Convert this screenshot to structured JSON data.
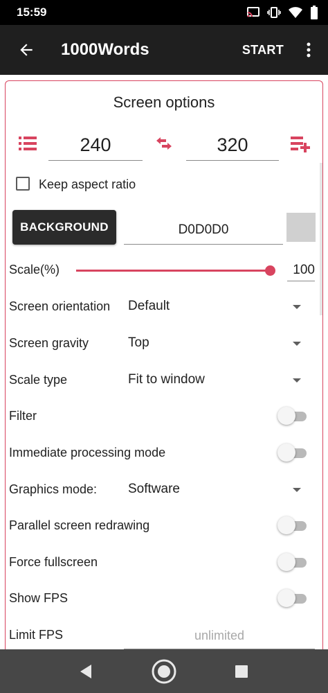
{
  "status_bar": {
    "time": "15:59",
    "icons": [
      "cast-icon",
      "vibrate-icon",
      "wifi-icon",
      "battery-icon"
    ]
  },
  "app_bar": {
    "back_icon": "arrow-left-icon",
    "title": "1000Words",
    "start_label": "START",
    "overflow_icon": "more-vert-icon"
  },
  "screen_options": {
    "title": "Screen options",
    "width_value": "240",
    "height_value": "320",
    "keep_aspect_label": "Keep aspect ratio",
    "keep_aspect_checked": false,
    "background_button": "BACKGROUND",
    "background_color_value": "D0D0D0",
    "background_swatch_color": "#d0d0d0",
    "scale_label": "Scale(%)",
    "scale_value": "100",
    "scale_slider_level": 1.0,
    "accent_color": "#d8445f"
  },
  "dropdowns": [
    {
      "label": "Screen orientation",
      "value": "Default"
    },
    {
      "label": "Screen gravity",
      "value": "Top"
    },
    {
      "label": "Scale type",
      "value": "Fit to window"
    },
    {
      "label": "Graphics mode:",
      "value": "Software"
    }
  ],
  "toggles": [
    {
      "label": "Filter",
      "on": false
    },
    {
      "label": "Immediate processing mode",
      "on": false
    },
    {
      "label": "Parallel screen redrawing",
      "on": false
    },
    {
      "label": "Force fullscreen",
      "on": false
    },
    {
      "label": "Show FPS",
      "on": false
    }
  ],
  "limit_fps": {
    "label": "Limit FPS",
    "placeholder": "unlimited"
  },
  "nav_bar": {
    "icons": [
      "back-triangle-icon",
      "home-circle-icon",
      "recents-square-icon"
    ]
  }
}
